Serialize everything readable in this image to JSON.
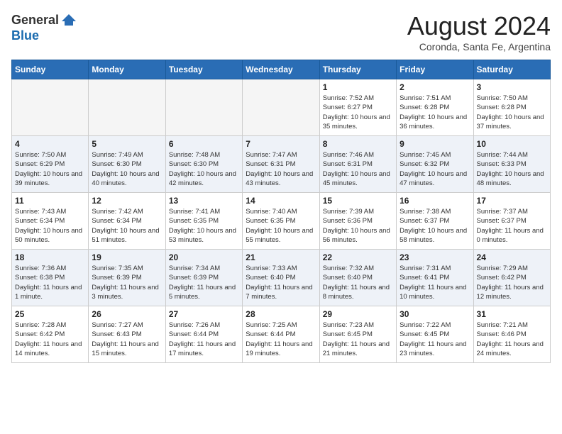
{
  "header": {
    "logo_general": "General",
    "logo_blue": "Blue",
    "month_title": "August 2024",
    "location": "Coronda, Santa Fe, Argentina"
  },
  "weekdays": [
    "Sunday",
    "Monday",
    "Tuesday",
    "Wednesday",
    "Thursday",
    "Friday",
    "Saturday"
  ],
  "weeks": [
    [
      {
        "day": "",
        "empty": true
      },
      {
        "day": "",
        "empty": true
      },
      {
        "day": "",
        "empty": true
      },
      {
        "day": "",
        "empty": true
      },
      {
        "day": "1",
        "sunrise": "7:52 AM",
        "sunset": "6:27 PM",
        "daylight": "10 hours and 35 minutes."
      },
      {
        "day": "2",
        "sunrise": "7:51 AM",
        "sunset": "6:28 PM",
        "daylight": "10 hours and 36 minutes."
      },
      {
        "day": "3",
        "sunrise": "7:50 AM",
        "sunset": "6:28 PM",
        "daylight": "10 hours and 37 minutes."
      }
    ],
    [
      {
        "day": "4",
        "sunrise": "7:50 AM",
        "sunset": "6:29 PM",
        "daylight": "10 hours and 39 minutes."
      },
      {
        "day": "5",
        "sunrise": "7:49 AM",
        "sunset": "6:30 PM",
        "daylight": "10 hours and 40 minutes."
      },
      {
        "day": "6",
        "sunrise": "7:48 AM",
        "sunset": "6:30 PM",
        "daylight": "10 hours and 42 minutes."
      },
      {
        "day": "7",
        "sunrise": "7:47 AM",
        "sunset": "6:31 PM",
        "daylight": "10 hours and 43 minutes."
      },
      {
        "day": "8",
        "sunrise": "7:46 AM",
        "sunset": "6:31 PM",
        "daylight": "10 hours and 45 minutes."
      },
      {
        "day": "9",
        "sunrise": "7:45 AM",
        "sunset": "6:32 PM",
        "daylight": "10 hours and 47 minutes."
      },
      {
        "day": "10",
        "sunrise": "7:44 AM",
        "sunset": "6:33 PM",
        "daylight": "10 hours and 48 minutes."
      }
    ],
    [
      {
        "day": "11",
        "sunrise": "7:43 AM",
        "sunset": "6:34 PM",
        "daylight": "10 hours and 50 minutes."
      },
      {
        "day": "12",
        "sunrise": "7:42 AM",
        "sunset": "6:34 PM",
        "daylight": "10 hours and 51 minutes."
      },
      {
        "day": "13",
        "sunrise": "7:41 AM",
        "sunset": "6:35 PM",
        "daylight": "10 hours and 53 minutes."
      },
      {
        "day": "14",
        "sunrise": "7:40 AM",
        "sunset": "6:35 PM",
        "daylight": "10 hours and 55 minutes."
      },
      {
        "day": "15",
        "sunrise": "7:39 AM",
        "sunset": "6:36 PM",
        "daylight": "10 hours and 56 minutes."
      },
      {
        "day": "16",
        "sunrise": "7:38 AM",
        "sunset": "6:37 PM",
        "daylight": "10 hours and 58 minutes."
      },
      {
        "day": "17",
        "sunrise": "7:37 AM",
        "sunset": "6:37 PM",
        "daylight": "11 hours and 0 minutes."
      }
    ],
    [
      {
        "day": "18",
        "sunrise": "7:36 AM",
        "sunset": "6:38 PM",
        "daylight": "11 hours and 1 minute."
      },
      {
        "day": "19",
        "sunrise": "7:35 AM",
        "sunset": "6:39 PM",
        "daylight": "11 hours and 3 minutes."
      },
      {
        "day": "20",
        "sunrise": "7:34 AM",
        "sunset": "6:39 PM",
        "daylight": "11 hours and 5 minutes."
      },
      {
        "day": "21",
        "sunrise": "7:33 AM",
        "sunset": "6:40 PM",
        "daylight": "11 hours and 7 minutes."
      },
      {
        "day": "22",
        "sunrise": "7:32 AM",
        "sunset": "6:40 PM",
        "daylight": "11 hours and 8 minutes."
      },
      {
        "day": "23",
        "sunrise": "7:31 AM",
        "sunset": "6:41 PM",
        "daylight": "11 hours and 10 minutes."
      },
      {
        "day": "24",
        "sunrise": "7:29 AM",
        "sunset": "6:42 PM",
        "daylight": "11 hours and 12 minutes."
      }
    ],
    [
      {
        "day": "25",
        "sunrise": "7:28 AM",
        "sunset": "6:42 PM",
        "daylight": "11 hours and 14 minutes."
      },
      {
        "day": "26",
        "sunrise": "7:27 AM",
        "sunset": "6:43 PM",
        "daylight": "11 hours and 15 minutes."
      },
      {
        "day": "27",
        "sunrise": "7:26 AM",
        "sunset": "6:44 PM",
        "daylight": "11 hours and 17 minutes."
      },
      {
        "day": "28",
        "sunrise": "7:25 AM",
        "sunset": "6:44 PM",
        "daylight": "11 hours and 19 minutes."
      },
      {
        "day": "29",
        "sunrise": "7:23 AM",
        "sunset": "6:45 PM",
        "daylight": "11 hours and 21 minutes."
      },
      {
        "day": "30",
        "sunrise": "7:22 AM",
        "sunset": "6:45 PM",
        "daylight": "11 hours and 23 minutes."
      },
      {
        "day": "31",
        "sunrise": "7:21 AM",
        "sunset": "6:46 PM",
        "daylight": "11 hours and 24 minutes."
      }
    ]
  ]
}
